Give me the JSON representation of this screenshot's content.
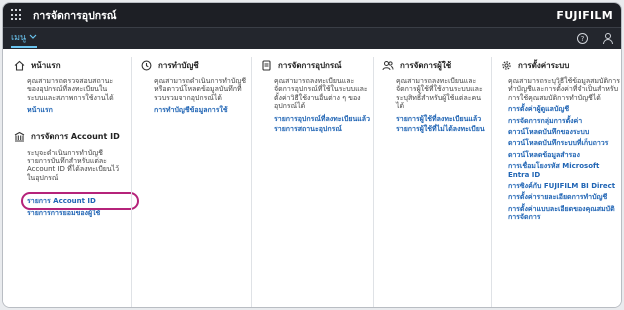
{
  "app": {
    "title": "การจัดการอุปกรณ์",
    "brand": "FUJIFILM"
  },
  "menubar": {
    "menu_label": "เมนู",
    "help_symbol": "?"
  },
  "columns": {
    "home": {
      "title": "หน้าแรก",
      "desc": "คุณสามารถตรวจสอบสถานะของอุปกรณ์ที่ลงทะเบียนในระบบและสภาพการใช้งานได้",
      "links": [
        "หน้าแรก"
      ]
    },
    "account": {
      "title": "การจัดการ Account ID",
      "desc": "ระบุจะดำเนินการทำบัญชีรายการบันทึกสำหรับแต่ละ Account ID ที่ได้ลงทะเบียนไว้ในอุปกรณ์",
      "links": [
        "รายการ Account ID",
        "รายการการยอมของผู้ใช้"
      ]
    },
    "billing": {
      "title": "การทำบัญชี",
      "desc": "คุณสามารถดำเนินการทำบัญชีหรือดาวน์โหลดข้อมูลบันทึกที่รวบรวมจากอุปกรณ์ได้",
      "links": [
        "การทำบัญชีข้อมูลการใช้"
      ]
    },
    "devices": {
      "title": "การจัดการอุปกรณ์",
      "desc": "คุณสามารถลงทะเบียนและจัดการอุปกรณ์ที่ใช้ในระบบและตั้งค่าวิธีใช้งานอื่นต่าง ๆ ของอุปกรณ์ได้",
      "links": [
        "รายการอุปกรณ์ที่ลงทะเบียนแล้ว",
        "รายการสถานะอุปกรณ์"
      ]
    },
    "users": {
      "title": "การจัดการผู้ใช้",
      "desc": "คุณสามารถลงทะเบียนและจัดการผู้ใช้ที่ใช้งานระบบและระบุสิทธิ์สำหรับผู้ใช้แต่ละคนได้",
      "links": [
        "รายการผู้ใช้ที่ลงทะเบียนแล้ว",
        "รายการผู้ใช้ที่ไม่ได้ลงทะเบียน"
      ]
    },
    "settings": {
      "title": "การตั้งค่าระบบ",
      "desc": "คุณสามารถระบุวิธีใช้ข้อมูลสมบัติการทำบัญชีและการตั้งค่าที่จำเป็นสำหรับการใช้คุณสมบัติการทำบัญชีได้",
      "links": [
        "การตั้งค่าผู้ดูแลบัญชี",
        "การจัดการกลุ่มการตั้งค่า",
        "ดาวน์โหลดบันทึกของระบบ",
        "ดาวน์โหลดบันทึกระบบที่เก็บถาวร",
        "ดาวน์โหลดข้อมูลสำรอง",
        "การเชื่อมโยงรหัส Microsoft Entra ID",
        "การซิงค์กับ FUJIFILM BI Direct",
        "การตั้งค่ารายละเอียดการทำบัญชี",
        "การตั้งค่าแบบละเอียดของคุณสมบัติการจัดการ"
      ]
    }
  }
}
